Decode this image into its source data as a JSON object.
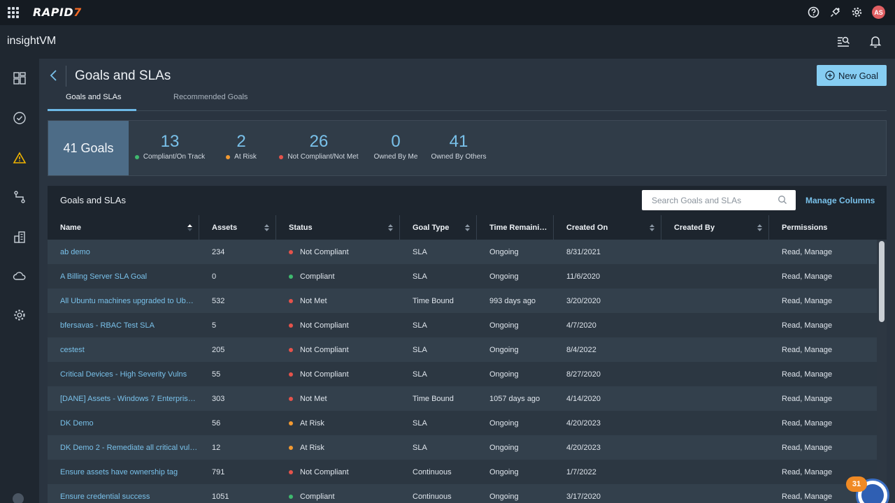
{
  "brand": {
    "logo": "RAPID",
    "logo_mark": "7",
    "product": "insightVM"
  },
  "topbar_icons": [
    "apps-grid-icon",
    "help-icon",
    "plug-icon",
    "gear-icon"
  ],
  "user": {
    "initials": "AS",
    "avatar_color": "#e15f63"
  },
  "sidebar_icons": [
    "dashboard-icon",
    "check-circle-icon",
    "warning-triangle-icon",
    "route-icon",
    "building-icon",
    "cloud-icon",
    "gear-icon"
  ],
  "page": {
    "title": "Goals and SLAs",
    "new_goal_label": "New Goal"
  },
  "tabs": [
    {
      "label": "Goals and SLAs",
      "active": true
    },
    {
      "label": "Recommended Goals",
      "active": false
    }
  ],
  "summary": {
    "total": "41 Goals",
    "stats": [
      {
        "value": "13",
        "label": "Compliant/On Track",
        "color": "#3fb96e"
      },
      {
        "value": "2",
        "label": "At Risk",
        "color": "#f39a31"
      },
      {
        "value": "26",
        "label": "Not Compliant/Not Met",
        "color": "#e5534b"
      },
      {
        "value": "0",
        "label": "Owned By Me",
        "color": ""
      },
      {
        "value": "41",
        "label": "Owned By Others",
        "color": ""
      }
    ]
  },
  "table": {
    "title": "Goals and SLAs",
    "search_placeholder": "Search Goals and SLAs",
    "manage_columns": "Manage Columns",
    "columns": [
      "Name",
      "Assets",
      "Status",
      "Goal Type",
      "Time Remaini…",
      "Created On",
      "Created By",
      "Permissions"
    ],
    "rows": [
      {
        "name": "ab demo",
        "assets": "234",
        "status": "Not Compliant",
        "status_color": "#e5534b",
        "goal_type": "SLA",
        "time_remaining": "Ongoing",
        "created_on": "8/31/2021",
        "created_by": "",
        "permissions": "Read, Manage"
      },
      {
        "name": "A Billing Server SLA Goal",
        "assets": "0",
        "status": "Compliant",
        "status_color": "#3fb96e",
        "goal_type": "SLA",
        "time_remaining": "Ongoing",
        "created_on": "11/6/2020",
        "created_by": "",
        "permissions": "Read, Manage"
      },
      {
        "name": "All Ubuntu machines upgraded to Ub…",
        "assets": "532",
        "status": "Not Met",
        "status_color": "#e5534b",
        "goal_type": "Time Bound",
        "time_remaining": "993 days ago",
        "created_on": "3/20/2020",
        "created_by": "",
        "permissions": "Read, Manage"
      },
      {
        "name": "bfersavas - RBAC Test SLA",
        "assets": "5",
        "status": "Not Compliant",
        "status_color": "#e5534b",
        "goal_type": "SLA",
        "time_remaining": "Ongoing",
        "created_on": "4/7/2020",
        "created_by": "",
        "permissions": "Read, Manage"
      },
      {
        "name": "cestest",
        "assets": "205",
        "status": "Not Compliant",
        "status_color": "#e5534b",
        "goal_type": "SLA",
        "time_remaining": "Ongoing",
        "created_on": "8/4/2022",
        "created_by": "",
        "permissions": "Read, Manage"
      },
      {
        "name": "Critical Devices - High Severity Vulns",
        "assets": "55",
        "status": "Not Compliant",
        "status_color": "#e5534b",
        "goal_type": "SLA",
        "time_remaining": "Ongoing",
        "created_on": "8/27/2020",
        "created_by": "",
        "permissions": "Read, Manage"
      },
      {
        "name": "[DANE] Assets - Windows 7 Enterpris…",
        "assets": "303",
        "status": "Not Met",
        "status_color": "#e5534b",
        "goal_type": "Time Bound",
        "time_remaining": "1057 days ago",
        "created_on": "4/14/2020",
        "created_by": "",
        "permissions": "Read, Manage"
      },
      {
        "name": "DK Demo",
        "assets": "56",
        "status": "At Risk",
        "status_color": "#f39a31",
        "goal_type": "SLA",
        "time_remaining": "Ongoing",
        "created_on": "4/20/2023",
        "created_by": "",
        "permissions": "Read, Manage"
      },
      {
        "name": "DK Demo 2 - Remediate all critical vul…",
        "assets": "12",
        "status": "At Risk",
        "status_color": "#f39a31",
        "goal_type": "SLA",
        "time_remaining": "Ongoing",
        "created_on": "4/20/2023",
        "created_by": "",
        "permissions": "Read, Manage"
      },
      {
        "name": "Ensure assets have ownership tag",
        "assets": "791",
        "status": "Not Compliant",
        "status_color": "#e5534b",
        "goal_type": "Continuous",
        "time_remaining": "Ongoing",
        "created_on": "1/7/2022",
        "created_by": "",
        "permissions": "Read, Manage"
      },
      {
        "name": "Ensure credential success",
        "assets": "1051",
        "status": "Compliant",
        "status_color": "#3fb96e",
        "goal_type": "Continuous",
        "time_remaining": "Ongoing",
        "created_on": "3/17/2020",
        "created_by": "",
        "permissions": "Read, Manage"
      }
    ]
  },
  "notification_badge": "31"
}
